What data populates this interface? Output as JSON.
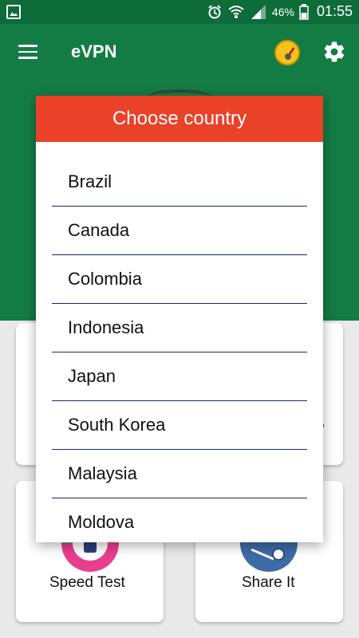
{
  "status_bar": {
    "battery": "46%",
    "time": "01:55"
  },
  "app": {
    "title": "eVPN"
  },
  "main": {
    "cards": [
      {
        "label": "Speed Test"
      },
      {
        "label": "Share It"
      },
      {
        "label": "y"
      }
    ]
  },
  "dialog": {
    "title": "Choose country",
    "countries": [
      "Brazil",
      "Canada",
      "Colombia",
      "Indonesia",
      "Japan",
      "South Korea",
      "Malaysia",
      "Moldova"
    ]
  },
  "colors": {
    "status_bar": "#0e6b3a",
    "appbar": "#137c44",
    "dialog_header": "#ea4229",
    "divider": "#1a2a6c"
  }
}
